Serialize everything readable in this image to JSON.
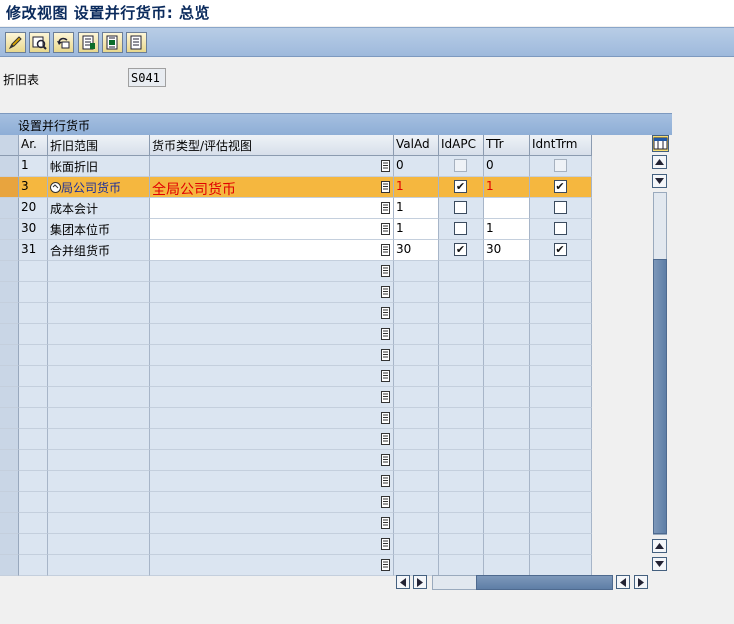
{
  "title": "修改视图 设置并行货币: 总览",
  "toolbar": {
    "buttons": [
      "edit-icon",
      "select-detail-icon",
      "undo-icon",
      "select-all-icon",
      "select-block-icon",
      "deselect-all-icon"
    ]
  },
  "field": {
    "label": "折旧表",
    "value": "S041"
  },
  "panel": {
    "title": "设置并行货币",
    "columns": [
      "Ar.",
      "折旧范围",
      "货币类型/评估视图",
      "ValAd",
      "IdAPC",
      "TTr",
      "IdntTrm"
    ],
    "rows": [
      {
        "ar": "1",
        "area": "帐面折旧",
        "currency": "",
        "valad": "0",
        "idapc": false,
        "ttr": "0",
        "idnt": false,
        "disabled": true
      },
      {
        "ar": "3",
        "area": "局公司货币",
        "currency": "全局公司货币",
        "valad": "1",
        "idapc": true,
        "ttr": "1",
        "idnt": true,
        "selected": true
      },
      {
        "ar": "20",
        "area": "成本会计",
        "currency": "",
        "valad": "1",
        "idapc": false,
        "ttr": "",
        "idnt": false
      },
      {
        "ar": "30",
        "area": "集团本位币",
        "currency": "",
        "valad": "1",
        "idapc": false,
        "ttr": "1",
        "idnt": false
      },
      {
        "ar": "31",
        "area": "合并组货币",
        "currency": "",
        "valad": "30",
        "idapc": true,
        "ttr": "30",
        "idnt": true
      }
    ],
    "empty_rows": 15
  },
  "colors": {
    "header_bar": "#9eb9dc",
    "selected_row": "#f5b73f",
    "red_text": "#e00000"
  }
}
